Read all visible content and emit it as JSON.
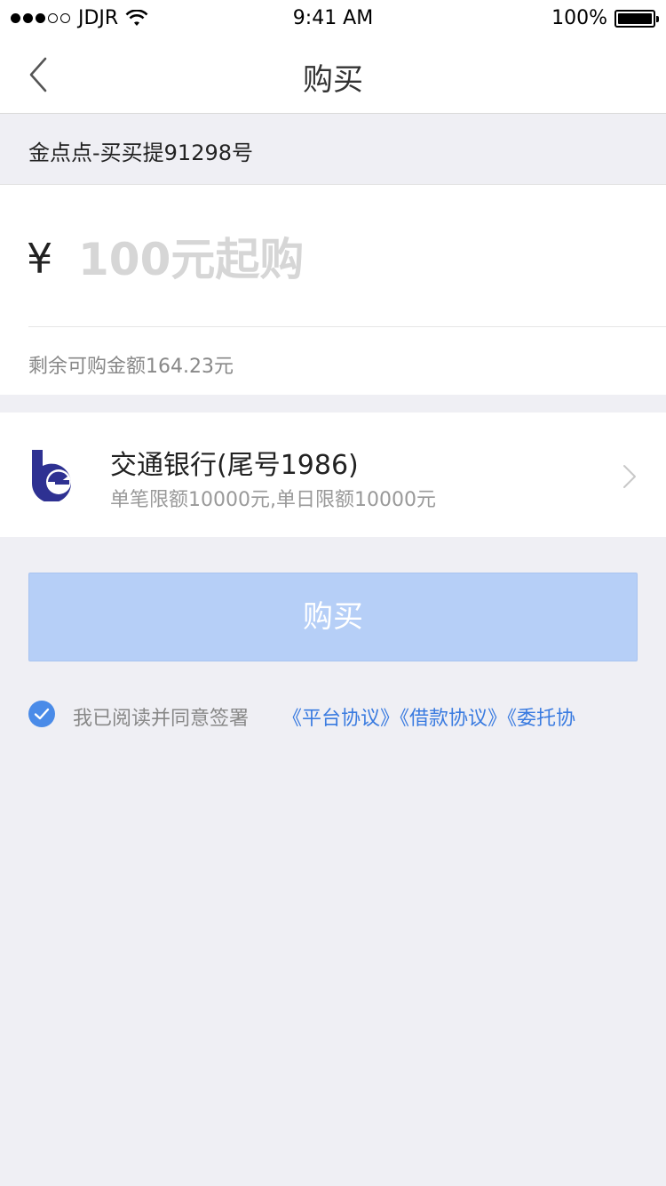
{
  "status_bar": {
    "carrier": "JDJR",
    "time": "9:41 AM",
    "battery": "100%"
  },
  "nav": {
    "title": "购买"
  },
  "product": {
    "name": "金点点-买买提91298号"
  },
  "amount": {
    "currency_symbol": "¥",
    "placeholder": "100元起购",
    "value": "",
    "remaining_text": "剩余可购金额164.23元"
  },
  "bank": {
    "name": "交通银行(尾号1986)",
    "limit_text": "单笔限额10000元,单日限额10000元"
  },
  "buy_button": {
    "label": "购买"
  },
  "agreement": {
    "checked": true,
    "text": "我已阅读并同意签署",
    "links": [
      "《平台协议》",
      "《借款协议》",
      "《委托协"
    ]
  },
  "colors": {
    "accent": "#4a8be8",
    "link": "#3a7be0",
    "button_disabled": "#b6cff7",
    "background": "#efeff4",
    "bank_logo": "#2e3192"
  }
}
